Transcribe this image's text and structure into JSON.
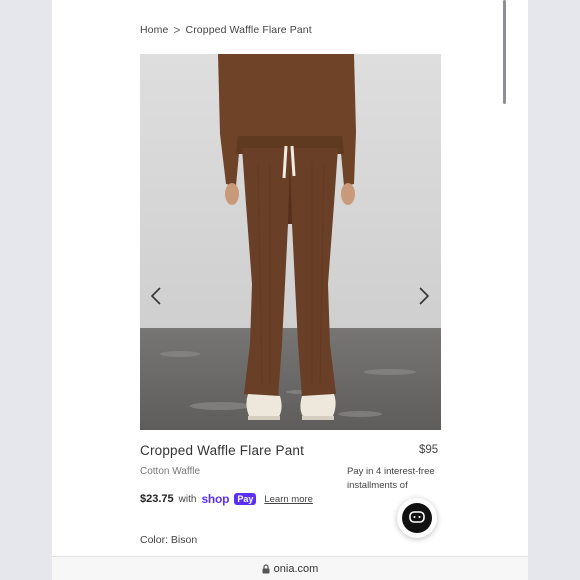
{
  "breadcrumb": {
    "home": "Home",
    "separator": ">",
    "current": "Cropped Waffle Flare Pant"
  },
  "gallery": {
    "prev_icon": "chevron-left-icon",
    "next_icon": "chevron-right-icon"
  },
  "product": {
    "title": "Cropped Waffle Flare Pant",
    "price": "$95",
    "subtitle": "Cotton Waffle",
    "installments": "Pay in 4 interest-free installments of"
  },
  "shop_pay": {
    "amount": "$23.75",
    "with": "with",
    "brand": "shop",
    "pay_badge": "Pay",
    "learn_more": "Learn more",
    "brand_color": "#5a31f4"
  },
  "chat_icon": "chat-icon",
  "color": {
    "label": "Color: Bison"
  },
  "browser": {
    "url": "onia.com",
    "lock_icon": "lock-icon"
  }
}
